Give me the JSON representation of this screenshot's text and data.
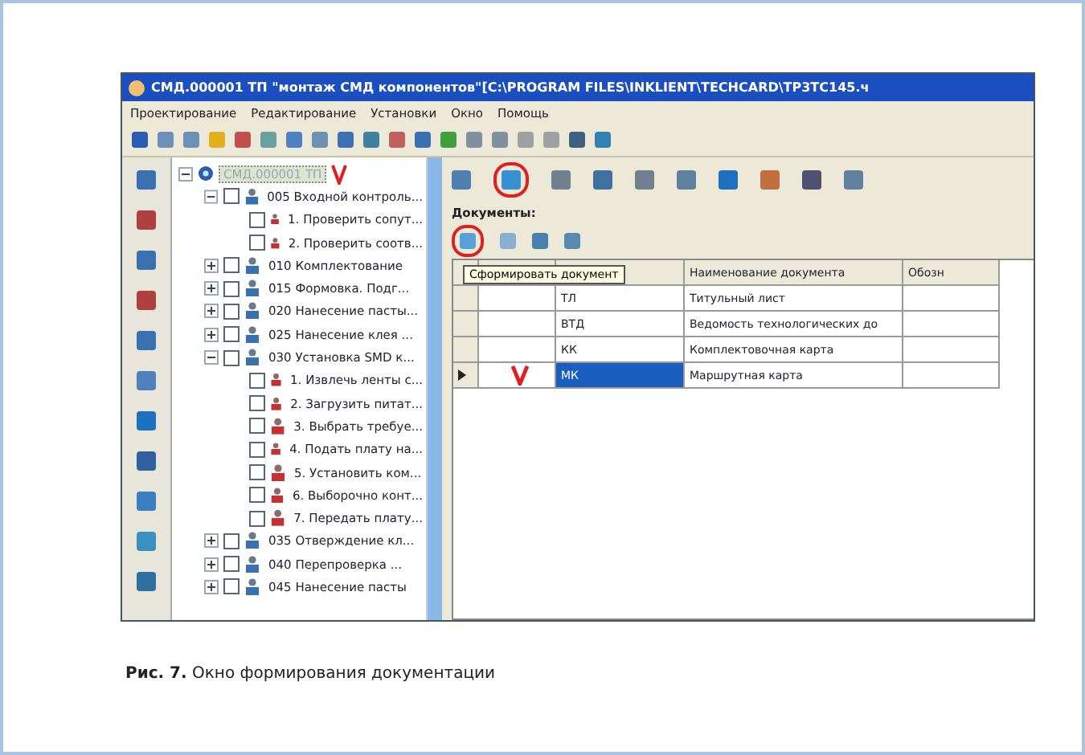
{
  "window": {
    "title": "СМД.000001 ТП \"монтаж СМД компонентов\"[C:\\PROGRAM FILES\\INKLIENT\\TECHCARD\\TP3TC145.ч"
  },
  "menu": [
    "Проектирование",
    "Редактирование",
    "Установки",
    "Окно",
    "Помощь"
  ],
  "tree": [
    {
      "label": "СМД.000001 ТП",
      "kind": "root",
      "selected": true,
      "expanded": true,
      "children": [
        {
          "label": "005 Входной контроль...",
          "kind": "operation",
          "selected": false,
          "checked": false,
          "expanded": true,
          "children": [
            {
              "label": "1. Проверить сопут...",
              "kind": "step",
              "selected": false,
              "checked": false
            },
            {
              "label": "2. Проверить соотв...",
              "kind": "step",
              "selected": false,
              "checked": false
            }
          ]
        },
        {
          "label": "010 Комплектование",
          "kind": "operation",
          "selected": false,
          "checked": false,
          "expanded": false
        },
        {
          "label": "015 Формовка. Подг...",
          "kind": "operation",
          "selected": false,
          "checked": false,
          "expanded": false
        },
        {
          "label": "020 Нанесение пасты...",
          "kind": "operation",
          "selected": false,
          "checked": false,
          "expanded": false
        },
        {
          "label": "025 Нанесение клея ...",
          "kind": "operation",
          "selected": false,
          "checked": false,
          "expanded": false
        },
        {
          "label": "030 Установка SMD к...",
          "kind": "operation",
          "selected": false,
          "checked": false,
          "expanded": true,
          "children": [
            {
              "label": "1. Извлечь ленты с...",
              "kind": "step",
              "selected": false,
              "checked": false
            },
            {
              "label": "2. Загрузить питат...",
              "kind": "step",
              "selected": false,
              "checked": false
            },
            {
              "label": "3. Выбрать требуе...",
              "kind": "step",
              "selected": false,
              "checked": false
            },
            {
              "label": "4. Подать плату на...",
              "kind": "step",
              "selected": false,
              "checked": false
            },
            {
              "label": "5. Установить ком...",
              "kind": "step",
              "selected": false,
              "checked": false
            },
            {
              "label": "6. Выборочно конт...",
              "kind": "step",
              "selected": false,
              "checked": false
            },
            {
              "label": "7. Передать плату...",
              "kind": "step",
              "selected": false,
              "checked": false
            }
          ]
        },
        {
          "label": "035 Отверждение кл...",
          "kind": "operation",
          "selected": false,
          "checked": false,
          "expanded": false
        },
        {
          "label": "040 Перепроверка ...",
          "kind": "operation",
          "selected": false,
          "checked": false,
          "expanded": false
        },
        {
          "label": "045 Нанесение пасты",
          "kind": "operation",
          "selected": false,
          "checked": false,
          "expanded": false
        }
      ]
    }
  ],
  "documents": {
    "label": "Документы:",
    "tooltip": "Сформировать документ",
    "columns": [
      "Наименование документа",
      "Обозн"
    ],
    "rows": [
      {
        "code": "ТЛ",
        "name": "Титульный лист",
        "selected": false
      },
      {
        "code": "ВТД",
        "name": "Ведомость технологических до",
        "selected": false
      },
      {
        "code": "КК",
        "name": "Комплектовочная карта",
        "selected": false
      },
      {
        "code": "МК",
        "name": "Маршрутная карта",
        "selected": true
      }
    ]
  },
  "caption": "**Рис. 7.** Окно формирования документации"
}
